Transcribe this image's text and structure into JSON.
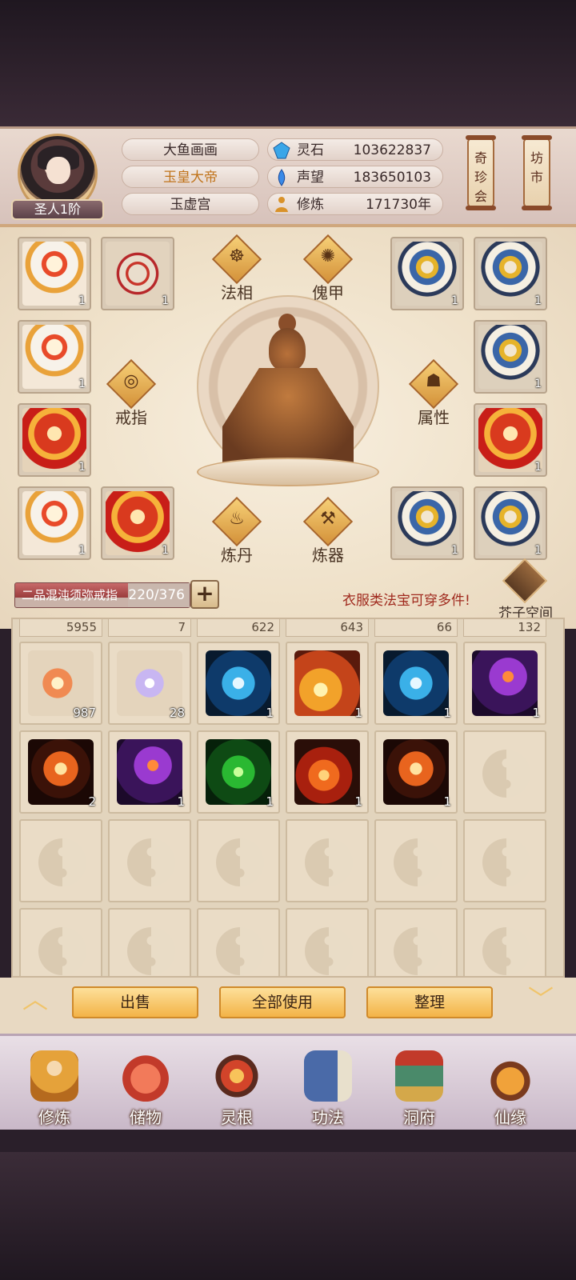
{
  "player": {
    "name": "大鱼画画",
    "title": "玉皇大帝",
    "sect": "玉虚宫",
    "rank": "圣人1阶"
  },
  "resources": [
    {
      "label": "灵石",
      "value": "103622837",
      "icon": "spirit-stone-icon",
      "color": "#3aa6e8"
    },
    {
      "label": "声望",
      "value": "183650103",
      "icon": "prestige-icon",
      "color": "#3a8ae8"
    },
    {
      "label": "修炼",
      "value": "171730年",
      "icon": "meditation-icon",
      "color": "#d9922a"
    }
  ],
  "side_buttons": {
    "treasure": "奇珍会",
    "market": "坊市"
  },
  "equipment": {
    "left_slots": [
      {
        "count": "1",
        "art": "art-white"
      },
      {
        "count": "1",
        "art": "art-bow"
      },
      {
        "count": "1",
        "art": "art-white"
      },
      {
        "count": "1",
        "art": "art-red"
      },
      {
        "count": "1",
        "art": "art-white"
      },
      {
        "count": "1",
        "art": "art-red"
      }
    ],
    "right_slots": [
      {
        "count": "1",
        "art": "art-blue"
      },
      {
        "count": "1",
        "art": "art-blue"
      },
      {
        "count": "1",
        "art": "art-blue"
      },
      {
        "count": "1",
        "art": "art-red"
      },
      {
        "count": "1",
        "art": "art-blue"
      },
      {
        "count": "1",
        "art": "art-blue"
      }
    ],
    "functions": {
      "faxiang": "法相",
      "kuijia": "傀甲",
      "jiezhi": "戒指",
      "shuxing": "属性",
      "liandan": "炼丹",
      "lianqi": "炼器"
    }
  },
  "bag": {
    "ring_name": "二品混沌须弥戒指",
    "capacity": "220/376",
    "notice": "衣服类法宝可穿多件!",
    "space_button": "芥子空间"
  },
  "inventory": {
    "top_counts": [
      "5955",
      "7",
      "622",
      "643",
      "66",
      "132"
    ],
    "row1": [
      {
        "count": "987",
        "kind": "sk-bird"
      },
      {
        "count": "28",
        "kind": "sk-yin"
      },
      {
        "count": "1",
        "kind": "sk-blue"
      },
      {
        "count": "1",
        "kind": "sk-gold"
      },
      {
        "count": "1",
        "kind": "sk-blue"
      },
      {
        "count": "1",
        "kind": "sk-purple"
      }
    ],
    "row2": [
      {
        "count": "2",
        "kind": "sk-phoenix"
      },
      {
        "count": "1",
        "kind": "sk-purple"
      },
      {
        "count": "1",
        "kind": "sk-green"
      },
      {
        "count": "1",
        "kind": "sk-fire"
      },
      {
        "count": "1",
        "kind": "sk-phoenix"
      }
    ]
  },
  "actions": {
    "sell": "出售",
    "use_all": "全部使用",
    "sort": "整理"
  },
  "nav": [
    {
      "label": "修炼",
      "icon": "nav-xiulian"
    },
    {
      "label": "储物",
      "icon": "nav-chuwu"
    },
    {
      "label": "灵根",
      "icon": "nav-linggen"
    },
    {
      "label": "功法",
      "icon": "nav-gongfa"
    },
    {
      "label": "洞府",
      "icon": "nav-dongfu"
    },
    {
      "label": "仙缘",
      "icon": "nav-xianyuan"
    }
  ]
}
